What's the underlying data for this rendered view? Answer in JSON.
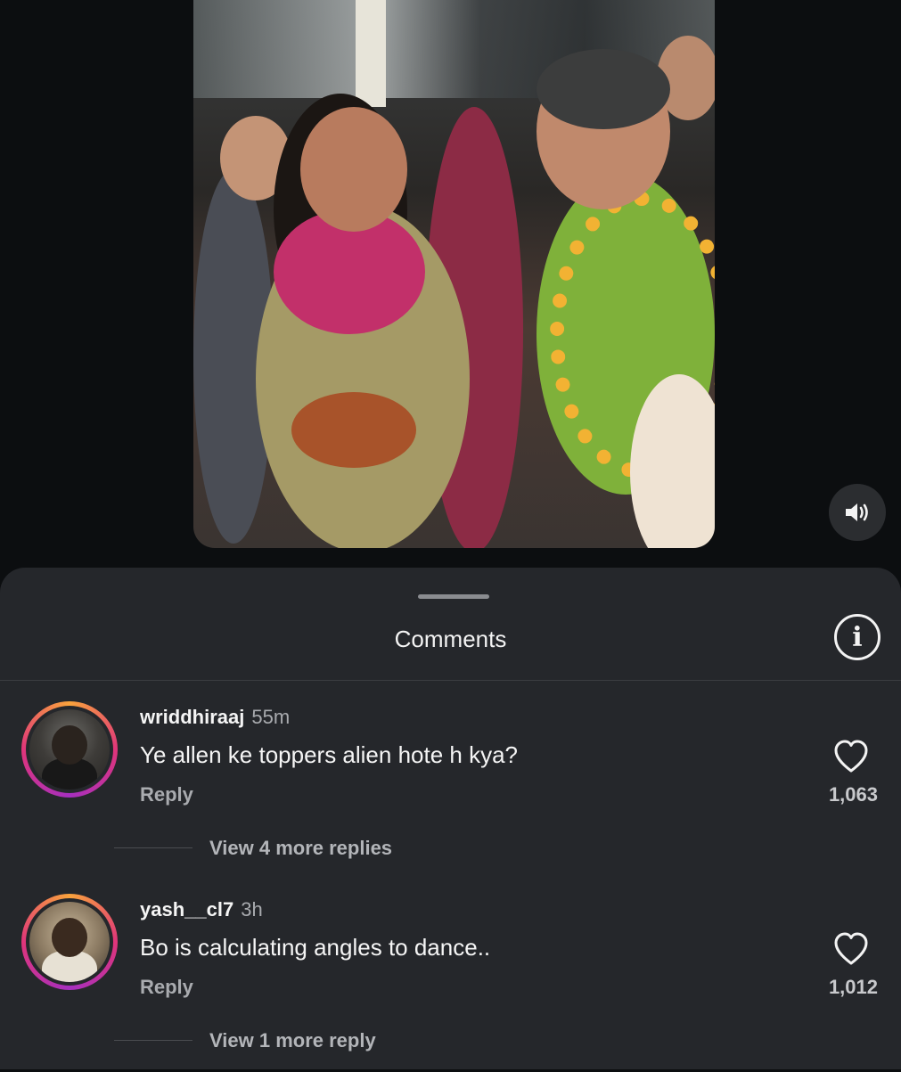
{
  "video": {
    "sound_icon": "speaker-volume-icon"
  },
  "sheet": {
    "title": "Comments",
    "info_icon": "info-icon",
    "info_glyph": "i"
  },
  "comments": [
    {
      "username": "wriddhiraaj",
      "time": "55m",
      "text": "Ye allen ke toppers alien hote h kya?",
      "reply_label": "Reply",
      "likes": "1,063",
      "more_replies": "View 4 more replies"
    },
    {
      "username": "yash__cl7",
      "time": "3h",
      "text": "Bo is calculating angles to dance..",
      "reply_label": "Reply",
      "likes": "1,012",
      "more_replies": "View 1 more reply"
    }
  ],
  "colors": {
    "background": "#0c0e10",
    "sheet": "#25272b",
    "avatar_ring_start": "#f9a33c",
    "avatar_ring_end": "#a62fbf"
  }
}
